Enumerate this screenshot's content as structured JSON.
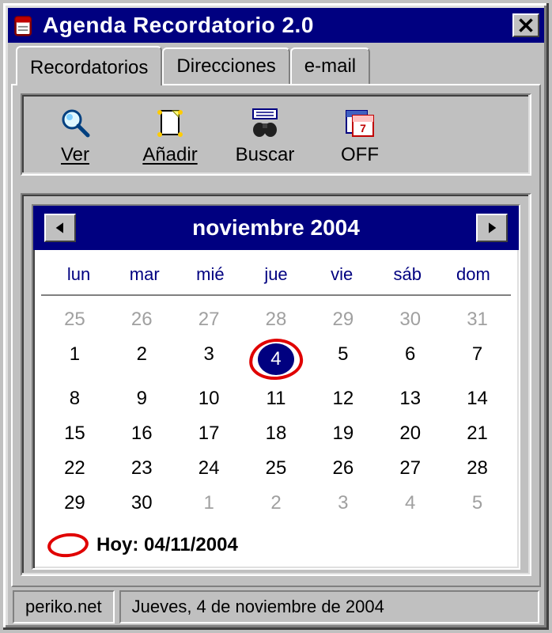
{
  "window": {
    "title": "Agenda Recordatorio 2.0"
  },
  "tabs": [
    {
      "label": "Recordatorios",
      "active": true
    },
    {
      "label": "Direcciones",
      "active": false
    },
    {
      "label": "e-mail",
      "active": false
    }
  ],
  "toolbar": {
    "ver": {
      "label": "Ver",
      "accel_index": 0
    },
    "anadir": {
      "label": "Añadir",
      "accel_index": 0
    },
    "buscar": {
      "label": "Buscar"
    },
    "off": {
      "label": "OFF"
    }
  },
  "calendar": {
    "month_label": "noviembre 2004",
    "dow": [
      "lun",
      "mar",
      "mié",
      "jue",
      "vie",
      "sáb",
      "dom"
    ],
    "weeks": [
      [
        {
          "n": 25,
          "gray": true
        },
        {
          "n": 26,
          "gray": true
        },
        {
          "n": 27,
          "gray": true
        },
        {
          "n": 28,
          "gray": true
        },
        {
          "n": 29,
          "gray": true
        },
        {
          "n": 30,
          "gray": true
        },
        {
          "n": 31,
          "gray": true
        }
      ],
      [
        {
          "n": 1
        },
        {
          "n": 2
        },
        {
          "n": 3
        },
        {
          "n": 4,
          "selected": true,
          "today": true
        },
        {
          "n": 5
        },
        {
          "n": 6
        },
        {
          "n": 7
        }
      ],
      [
        {
          "n": 8
        },
        {
          "n": 9
        },
        {
          "n": 10
        },
        {
          "n": 11
        },
        {
          "n": 12
        },
        {
          "n": 13
        },
        {
          "n": 14
        }
      ],
      [
        {
          "n": 15
        },
        {
          "n": 16
        },
        {
          "n": 17
        },
        {
          "n": 18
        },
        {
          "n": 19
        },
        {
          "n": 20
        },
        {
          "n": 21
        }
      ],
      [
        {
          "n": 22
        },
        {
          "n": 23
        },
        {
          "n": 24
        },
        {
          "n": 25
        },
        {
          "n": 26
        },
        {
          "n": 27
        },
        {
          "n": 28
        }
      ],
      [
        {
          "n": 29
        },
        {
          "n": 30
        },
        {
          "n": 1,
          "gray": true
        },
        {
          "n": 2,
          "gray": true
        },
        {
          "n": 3,
          "gray": true
        },
        {
          "n": 4,
          "gray": true
        },
        {
          "n": 5,
          "gray": true
        }
      ]
    ],
    "today_label": "Hoy: 04/11/2004"
  },
  "status": {
    "site": "periko.net",
    "date": "Jueves, 4 de noviembre de 2004"
  }
}
